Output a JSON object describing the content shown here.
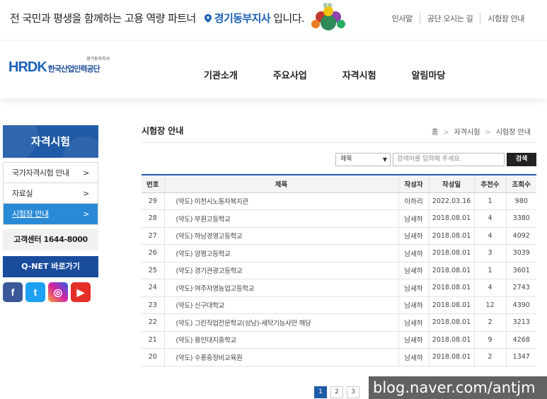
{
  "topbar": {
    "slogan_prefix": "전 국민과 평생을 함께하는 고용 역량 파트너",
    "branch": "경기동부지사",
    "slogan_suffix": "입니다.",
    "mascot_text": "뭉박·",
    "util_links": [
      "인사말",
      "공단 오시는 길",
      "시험장 안내"
    ]
  },
  "header": {
    "logo_mark": "HRDK",
    "logo_korean": "한국산업인력공단",
    "logo_branch": "경기동부지사",
    "nav": [
      "기관소개",
      "주요사업",
      "자격시험",
      "알림마당"
    ]
  },
  "sidebar": {
    "title": "자격시험",
    "items": [
      {
        "label": "국가자격시험 안내",
        "arrow": ">"
      },
      {
        "label": "자료실",
        "arrow": ">"
      },
      {
        "label": "시험장 안내",
        "arrow": ">"
      }
    ],
    "callcenter": "고객센터 1644-8000",
    "qnet": "Q-NET 바로가기",
    "social": [
      {
        "icon": "facebook-icon",
        "glyph": "f",
        "color": "#3b5998"
      },
      {
        "icon": "twitter-icon",
        "glyph": "t",
        "color": "#1da1f2"
      },
      {
        "icon": "instagram-icon",
        "glyph": "◎",
        "color": "#d6249f"
      },
      {
        "icon": "youtube-icon",
        "glyph": "▶",
        "color": "#e52d27"
      }
    ]
  },
  "main": {
    "title": "시험장 안내",
    "breadcrumb": [
      "홈",
      "자격시험",
      "시험장 안내"
    ],
    "search": {
      "select_value": "제목",
      "placeholder": "검색어를 입력해 주세요.",
      "button": "검색"
    },
    "table": {
      "headers": [
        "번호",
        "제목",
        "작성자",
        "작성일",
        "추천수",
        "조회수"
      ],
      "rows": [
        [
          "29",
          "(약도) 이천시노동자복지관",
          "이하리",
          "2022.03.16",
          "1",
          "980"
        ],
        [
          "28",
          "(약도) 부원고등학교",
          "남새하",
          "2018.08.01",
          "4",
          "3380"
        ],
        [
          "27",
          "(약도) 하남경영고등학교",
          "남새하",
          "2018.08.01",
          "4",
          "4092"
        ],
        [
          "26",
          "(약도) 양평고등학교",
          "남새하",
          "2018.08.01",
          "3",
          "3039"
        ],
        [
          "25",
          "(약도) 경기관광고등학교",
          "남새하",
          "2018.08.01",
          "1",
          "3601"
        ],
        [
          "24",
          "(약도) 여주자영농업고등학교",
          "남새하",
          "2018.08.01",
          "4",
          "2743"
        ],
        [
          "23",
          "(약도) 신구대학교",
          "남새하",
          "2018.08.01",
          "12",
          "4390"
        ],
        [
          "22",
          "(약도) 그린직업전문학교(성남)-세탁기능사만 해당",
          "남새하",
          "2018.08.01",
          "2",
          "3213"
        ],
        [
          "21",
          "(약도) 용인대지중학교",
          "남새하",
          "2018.08.01",
          "9",
          "4268"
        ],
        [
          "20",
          "(약도) 수풍중정비교육원",
          "남새하",
          "2018.08.01",
          "2",
          "1347"
        ]
      ]
    },
    "pagination": [
      "1",
      "2",
      "3"
    ],
    "current_page": "1"
  },
  "watermark": "blog.naver.com/antjm",
  "colors": {
    "primary": "#1f5aa6",
    "active": "#2a8ad6",
    "branch_text": "#1a5fb4"
  }
}
